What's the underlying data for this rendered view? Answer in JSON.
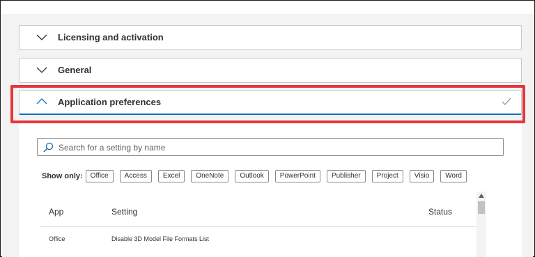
{
  "sections": [
    {
      "title": "Licensing and activation",
      "expanded": false
    },
    {
      "title": "General",
      "expanded": false
    },
    {
      "title": "Application preferences",
      "expanded": true
    }
  ],
  "search": {
    "placeholder": "Search for a setting by name"
  },
  "filters": {
    "label": "Show only:",
    "chips": [
      "Office",
      "Access",
      "Excel",
      "OneNote",
      "Outlook",
      "PowerPoint",
      "Publisher",
      "Project",
      "Visio",
      "Word"
    ]
  },
  "table": {
    "columns": [
      "App",
      "Setting",
      "Status"
    ],
    "rows": [
      {
        "app": "Office",
        "setting": "Disable 3D Model File Formats List",
        "status": ""
      }
    ]
  },
  "colors": {
    "accent": "#0f6cbd",
    "highlight": "#e5363b"
  }
}
